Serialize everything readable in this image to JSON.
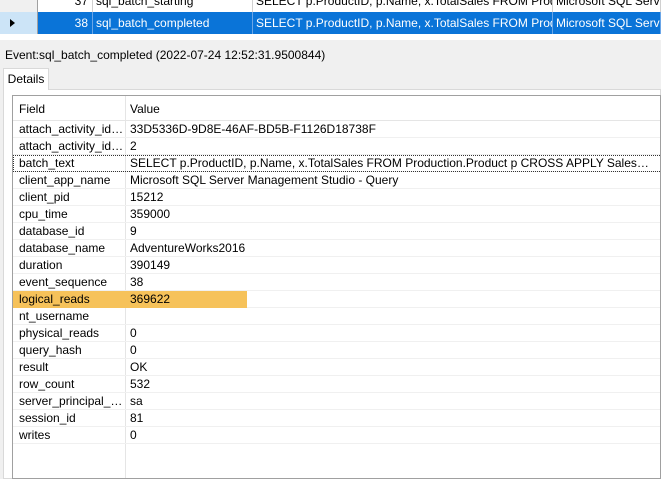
{
  "events_grid": {
    "rows": [
      {
        "num": "37",
        "name": "sql_batch_starting",
        "batch_text": "SELECT p.ProductID, p.Name, x.TotalSales FROM Produc...",
        "app": "Microsoft SQL Server",
        "selected": false
      },
      {
        "num": "38",
        "name": "sql_batch_completed",
        "batch_text": "SELECT p.ProductID, p.Name, x.TotalSales  FROM Produc...",
        "app": "Microsoft SQL Server",
        "selected": true
      }
    ]
  },
  "event_label": "Event:sql_batch_completed (2022-07-24 12:52:31.9500844)",
  "tabs": {
    "details": "Details"
  },
  "details": {
    "header": {
      "field": "Field",
      "value": "Value"
    },
    "rows": [
      {
        "field": "attach_activity_id.g...",
        "value": "33D5336D-9D8E-46AF-BD5B-F1126D18738F"
      },
      {
        "field": "attach_activity_id.s...",
        "value": "2"
      },
      {
        "field": "batch_text",
        "value": "SELECT p.ProductID, p.Name, x.TotalSales  FROM Production.Product p  CROSS APPLY Sales.GetSale..."
      },
      {
        "field": "client_app_name",
        "value": "Microsoft SQL Server Management Studio - Query"
      },
      {
        "field": "client_pid",
        "value": "15212"
      },
      {
        "field": "cpu_time",
        "value": "359000"
      },
      {
        "field": "database_id",
        "value": "9"
      },
      {
        "field": "database_name",
        "value": "AdventureWorks2016"
      },
      {
        "field": "duration",
        "value": "390149"
      },
      {
        "field": "event_sequence",
        "value": "38"
      },
      {
        "field": "logical_reads",
        "value": "369622"
      },
      {
        "field": "nt_username",
        "value": ""
      },
      {
        "field": "physical_reads",
        "value": "0"
      },
      {
        "field": "query_hash",
        "value": "0"
      },
      {
        "field": "result",
        "value": "OK"
      },
      {
        "field": "row_count",
        "value": "532"
      },
      {
        "field": "server_principal_na...",
        "value": "sa"
      },
      {
        "field": "session_id",
        "value": "81"
      },
      {
        "field": "writes",
        "value": "0"
      }
    ]
  },
  "highlight_color": "#f6c25a",
  "selection_color": "#0a74d8"
}
